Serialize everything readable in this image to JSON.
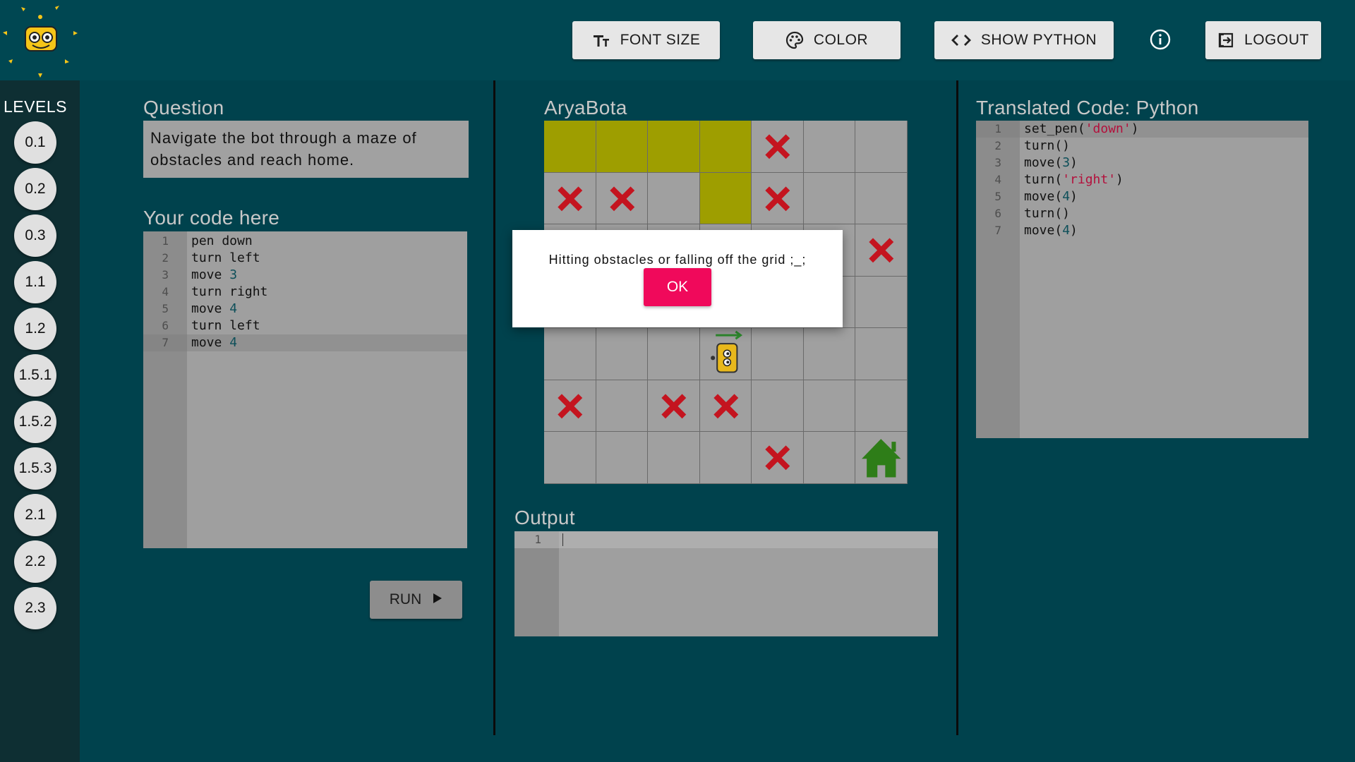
{
  "header": {
    "font_size_label": "FONT SIZE",
    "color_label": "COLOR",
    "show_python_label": "SHOW PYTHON",
    "logout_label": "LOGOUT"
  },
  "sidebar": {
    "title": "LEVELS",
    "levels": [
      "0.1",
      "0.2",
      "0.3",
      "1.1",
      "1.2",
      "1.5.1",
      "1.5.2",
      "1.5.3",
      "2.1",
      "2.2",
      "2.3"
    ]
  },
  "question": {
    "label": "Question",
    "text": "Navigate the bot through a maze of obstacles and reach home."
  },
  "code_editor": {
    "label": "Your code here",
    "lines": [
      [
        {
          "t": "pen down"
        }
      ],
      [
        {
          "t": "turn left"
        }
      ],
      [
        {
          "t": "move "
        },
        {
          "t": "3",
          "c": "num"
        }
      ],
      [
        {
          "t": "turn right"
        }
      ],
      [
        {
          "t": "move "
        },
        {
          "t": "4",
          "c": "num"
        }
      ],
      [
        {
          "t": "turn left"
        }
      ],
      [
        {
          "t": "move "
        },
        {
          "t": "4",
          "c": "num"
        }
      ]
    ]
  },
  "run_button": {
    "label": "RUN"
  },
  "board": {
    "label": "AryaBota",
    "rows": 7,
    "cols": 7,
    "path_cells": [
      [
        0,
        0
      ],
      [
        0,
        1
      ],
      [
        0,
        2
      ],
      [
        0,
        3
      ],
      [
        1,
        3
      ]
    ],
    "obstacles": [
      [
        0,
        4
      ],
      [
        1,
        0
      ],
      [
        1,
        1
      ],
      [
        1,
        4
      ],
      [
        2,
        6
      ],
      [
        5,
        0
      ],
      [
        5,
        2
      ],
      [
        5,
        3
      ],
      [
        6,
        4
      ]
    ],
    "home": [
      6,
      6
    ],
    "bot": [
      4,
      3
    ],
    "bot_direction": "right"
  },
  "output": {
    "label": "Output",
    "lines": [
      ""
    ]
  },
  "python": {
    "label": "Translated Code: Python",
    "lines": [
      [
        {
          "t": "set_pen("
        },
        {
          "t": "'down'",
          "c": "str"
        },
        {
          "t": ")"
        }
      ],
      [
        {
          "t": "turn()"
        }
      ],
      [
        {
          "t": "move("
        },
        {
          "t": "3",
          "c": "num"
        },
        {
          "t": ")"
        }
      ],
      [
        {
          "t": "turn("
        },
        {
          "t": "'right'",
          "c": "str"
        },
        {
          "t": ")"
        }
      ],
      [
        {
          "t": "move("
        },
        {
          "t": "4",
          "c": "num"
        },
        {
          "t": ")"
        }
      ],
      [
        {
          "t": "turn()"
        }
      ],
      [
        {
          "t": "move("
        },
        {
          "t": "4",
          "c": "num"
        },
        {
          "t": ")"
        }
      ]
    ]
  },
  "modal": {
    "message": "Hitting obstacles or falling off the grid ;_;",
    "ok_label": "OK"
  },
  "colors": {
    "background": "#00424d",
    "header": "#004752",
    "sidebar": "#0e2f33",
    "path": "#9e9e00",
    "obstacle": "#c4141f",
    "home": "#2e7d18",
    "ok_button": "#f0095b"
  }
}
